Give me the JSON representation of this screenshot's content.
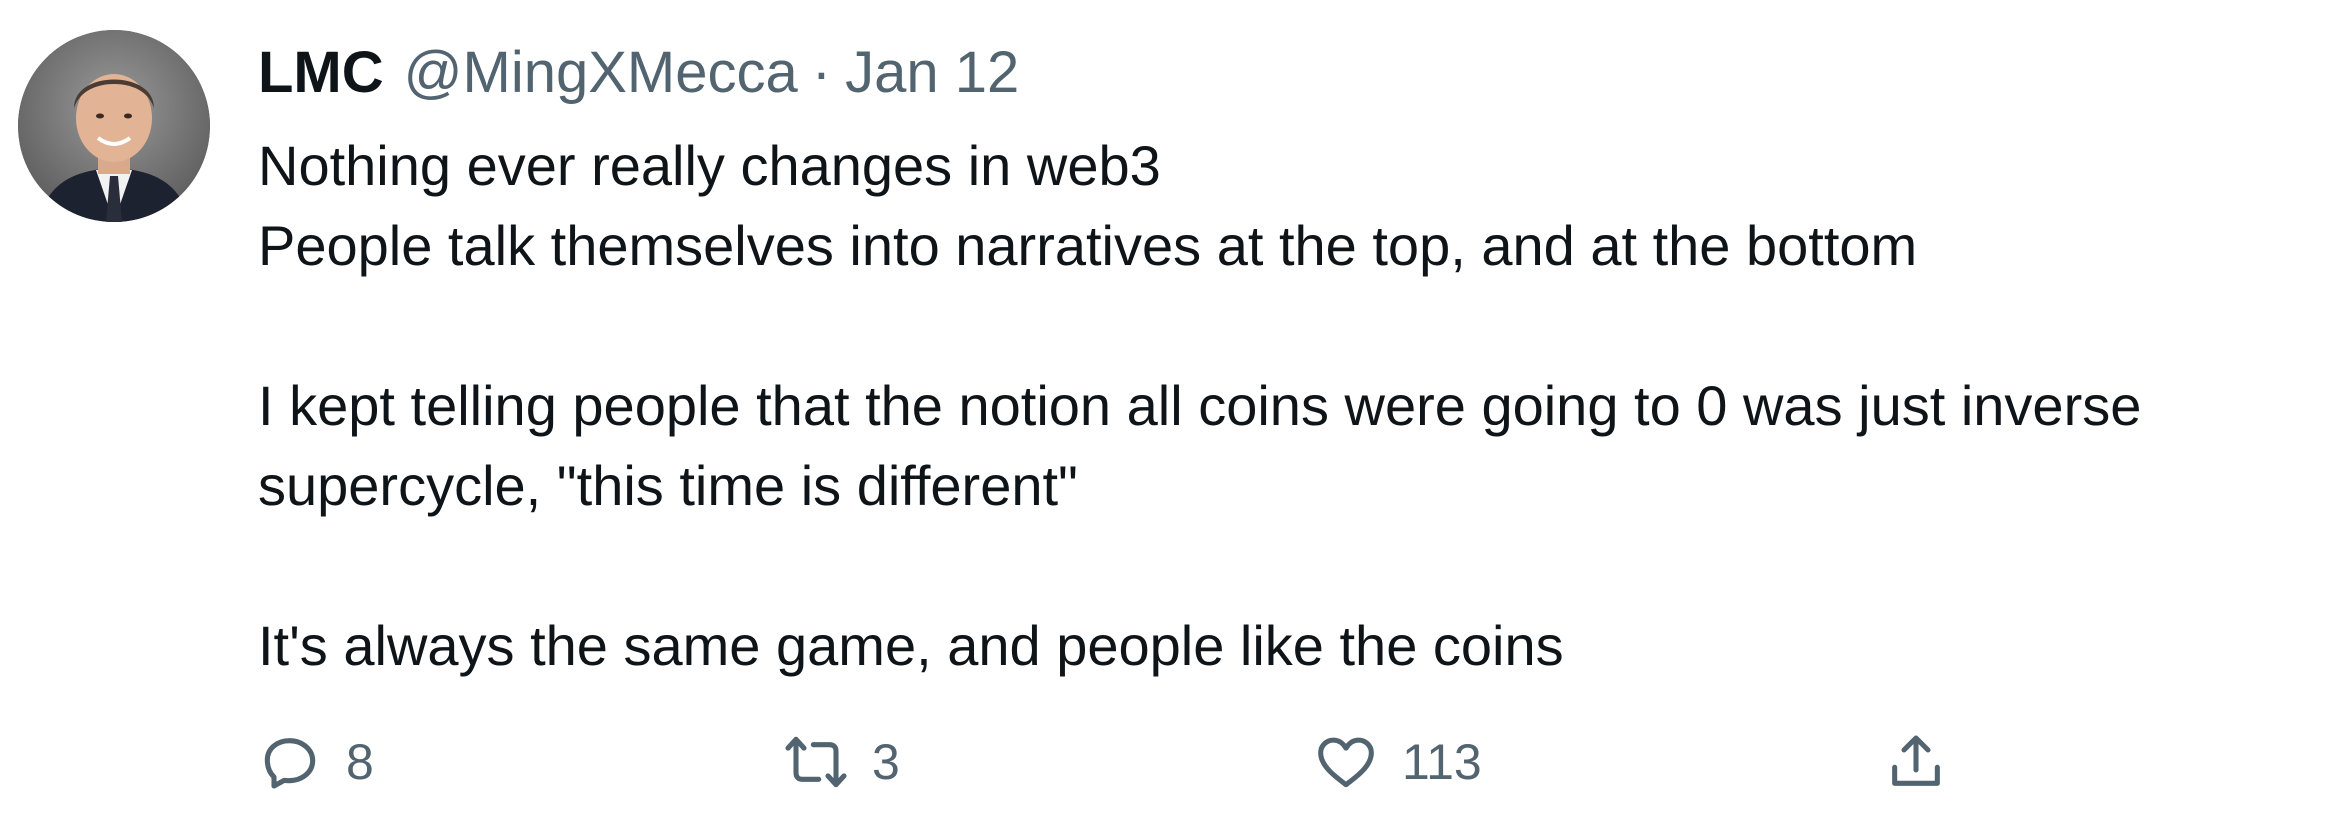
{
  "author": {
    "name": "LMC",
    "handle": "@MingXMecca",
    "separator": "·",
    "date": "Jan 12"
  },
  "tweet": {
    "lines": [
      "Nothing ever really changes in web3",
      "People talk themselves into narratives at the top, and at the bottom",
      "",
      "I kept telling people that the notion all coins were going to 0 was just inverse",
      "supercycle, \"this time is different\"",
      "",
      "It's always the same game, and people like the coins"
    ]
  },
  "actions": {
    "reply": {
      "icon": "reply-icon",
      "count": "8"
    },
    "retweet": {
      "icon": "retweet-icon",
      "count": "3"
    },
    "like": {
      "icon": "heart-icon",
      "count": "113"
    },
    "share": {
      "icon": "share-icon"
    }
  },
  "colors": {
    "text": "#0f1419",
    "secondary": "#536471"
  }
}
